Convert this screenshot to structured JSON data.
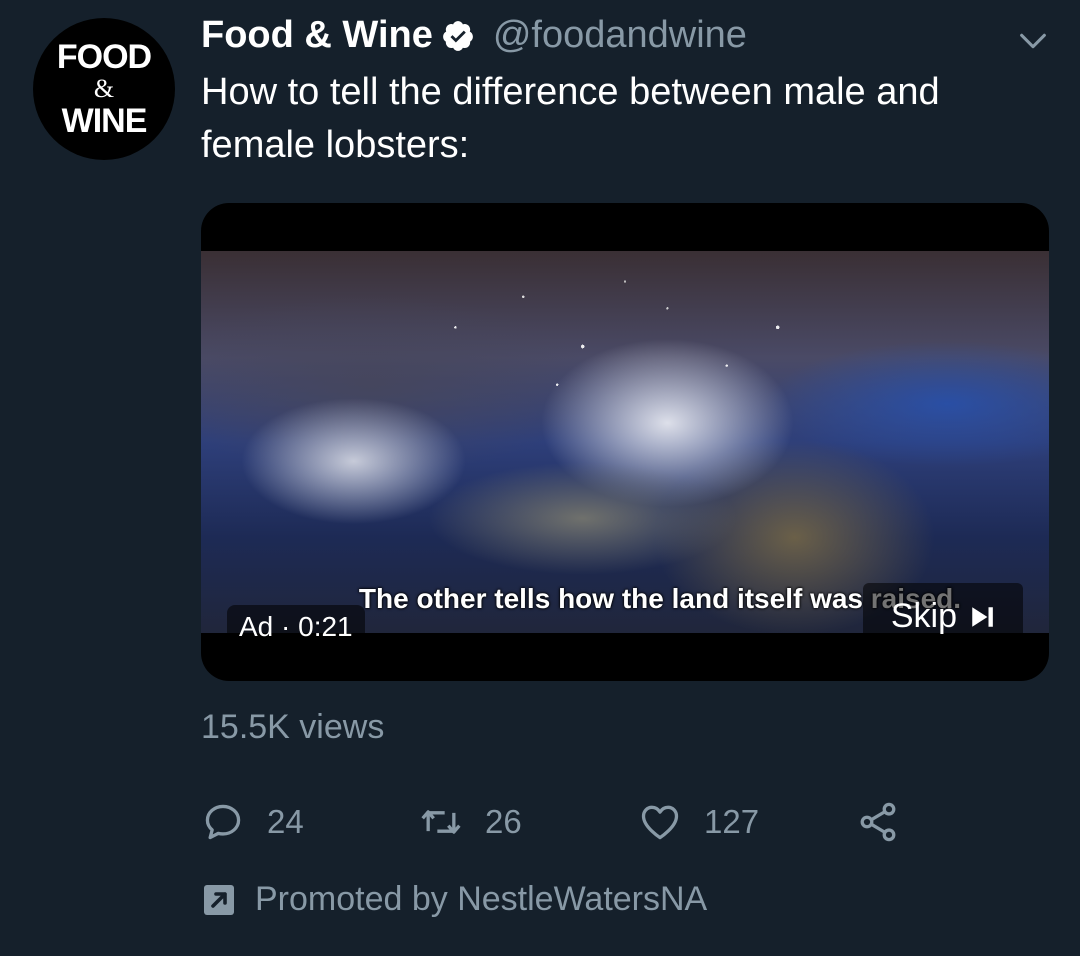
{
  "avatar": {
    "line1": "FOOD",
    "line2": "&",
    "line3": "WINE",
    "icon": "food-and-wine-logo"
  },
  "header": {
    "display_name": "Food & Wine",
    "handle": "@foodandwine",
    "verified_icon": "verified-badge-icon",
    "menu_icon": "chevron-down-icon"
  },
  "tweet": {
    "text": "How to tell the difference between male and female lobsters:"
  },
  "media": {
    "subtitle": "The other tells how the land itself was raised.",
    "ad_label": "Ad · 0:21",
    "skip_label": "Skip",
    "skip_icon": "skip-next-icon"
  },
  "stats": {
    "views": "15.5K views"
  },
  "actions": {
    "reply": {
      "count": "24",
      "icon": "reply-icon"
    },
    "retweet": {
      "count": "26",
      "icon": "retweet-icon"
    },
    "like": {
      "count": "127",
      "icon": "heart-icon"
    },
    "share": {
      "icon": "share-icon"
    }
  },
  "promoted": {
    "text": "Promoted by NestleWatersNA",
    "icon": "promoted-arrow-icon"
  },
  "colors": {
    "background": "#15202b",
    "secondary_text": "#8899a6",
    "verified": "#ffffff"
  }
}
